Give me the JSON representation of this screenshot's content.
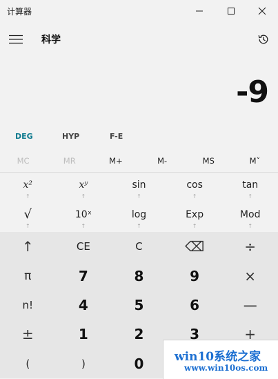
{
  "window": {
    "title": "计算器",
    "minimize_icon": "minimize-icon",
    "maximize_icon": "maximize-icon",
    "close_icon": "close-icon"
  },
  "header": {
    "menu_icon": "hamburger-icon",
    "mode": "科学",
    "history_icon": "history-icon"
  },
  "display": {
    "value": "-9"
  },
  "angle_row": {
    "deg": "DEG",
    "hyp": "HYP",
    "fe": "F-E"
  },
  "memory": {
    "items": [
      {
        "label": "MC",
        "enabled": false
      },
      {
        "label": "MR",
        "enabled": false
      },
      {
        "label": "M+",
        "enabled": true
      },
      {
        "label": "M-",
        "enabled": true
      },
      {
        "label": "MS",
        "enabled": true
      },
      {
        "label": "Mˇ",
        "enabled": true
      }
    ]
  },
  "scientific": {
    "row1": [
      "x²",
      "xʸ",
      "sin",
      "cos",
      "tan"
    ],
    "row2": [
      "√",
      "10ˣ",
      "log",
      "Exp",
      "Mod"
    ],
    "arrow": "↑"
  },
  "keypad": {
    "rows": [
      [
        "↑",
        "CE",
        "C",
        "⌫",
        "÷"
      ],
      [
        "π",
        "7",
        "8",
        "9",
        "×"
      ],
      [
        "n!",
        "4",
        "5",
        "6",
        "—"
      ],
      [
        "±",
        "1",
        "2",
        "3",
        "+"
      ],
      [
        "(",
        ")",
        "0",
        ".",
        "="
      ]
    ]
  },
  "watermark": {
    "line1": "win10系统之家",
    "line2": "www.win10os.com"
  },
  "colors": {
    "accent": "#0f7b8f",
    "background": "#f2f2f2",
    "keypad_bg": "#e6e6e6",
    "watermark_text": "#1c6fd1"
  }
}
